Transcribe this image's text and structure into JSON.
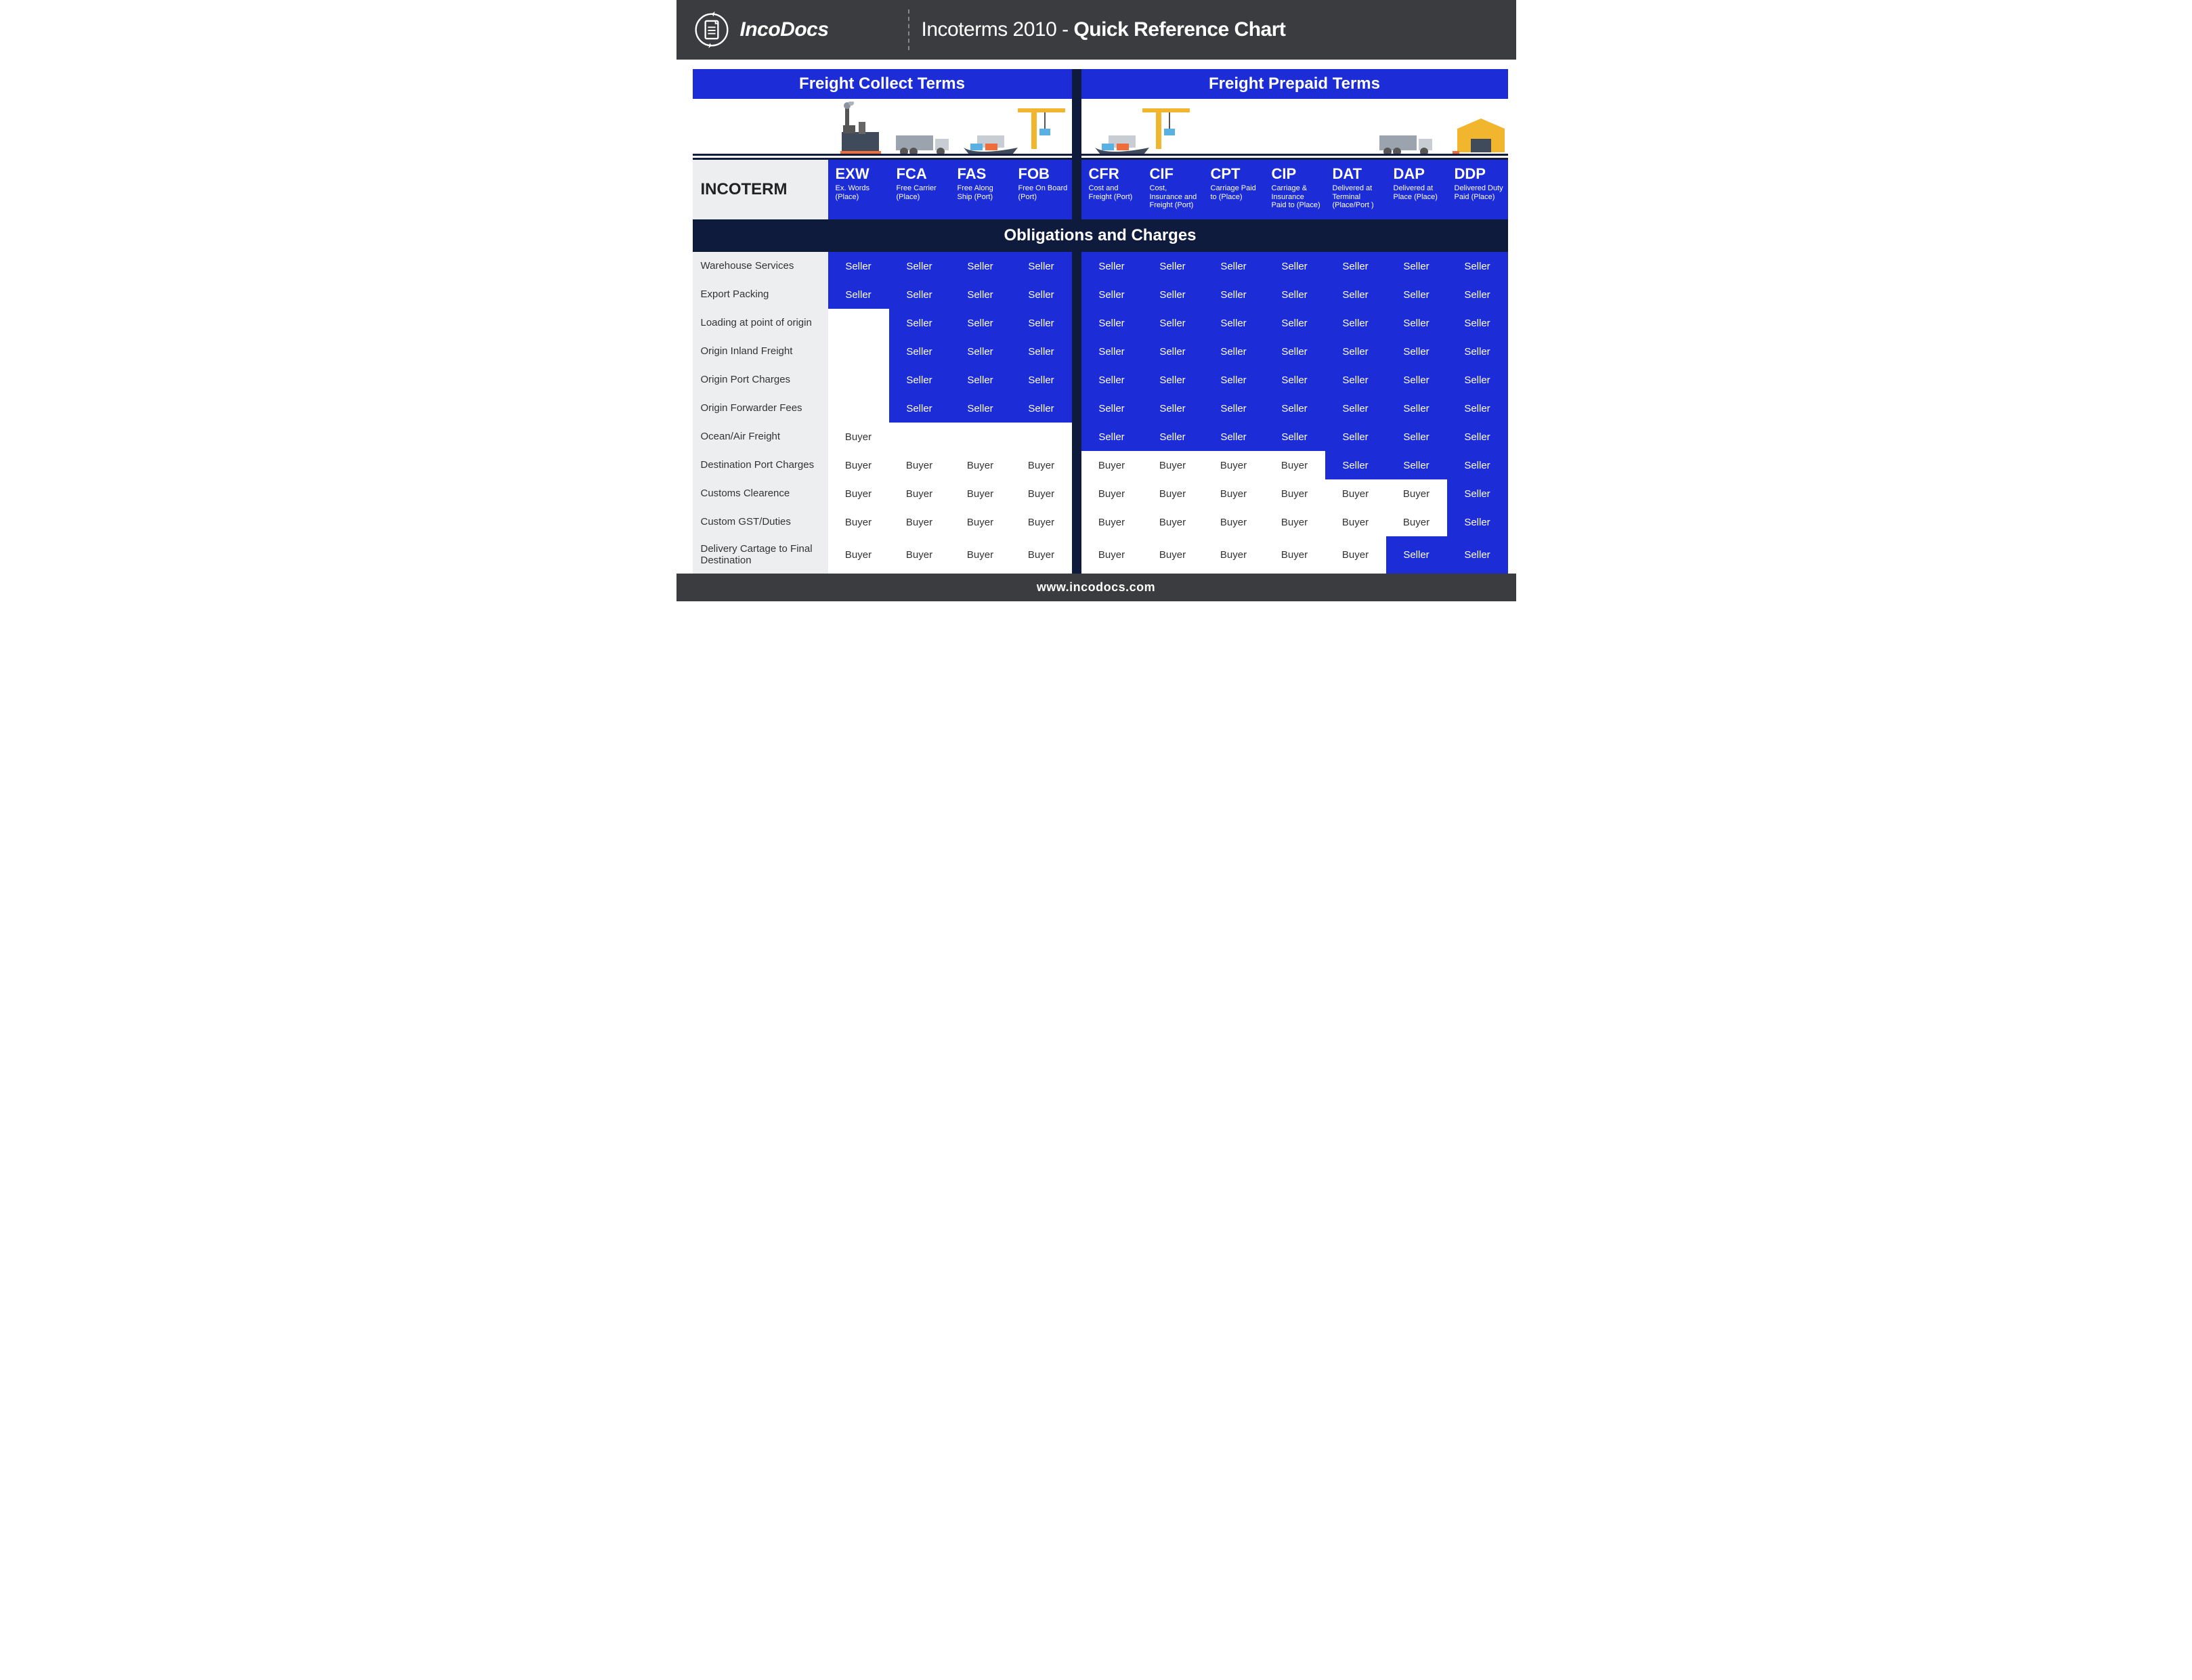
{
  "brand": "IncoDocs",
  "title_prefix": "Incoterms 2010 - ",
  "title_bold": "Quick Reference Chart",
  "sections": {
    "left": "Freight Collect Terms",
    "right": "Freight Prepaid Terms"
  },
  "incoterm_label": "INCOTERM",
  "obligations_title": "Obligations and Charges",
  "footer": "www.incodocs.com",
  "terms_left": [
    {
      "code": "EXW",
      "sub": "Ex. Words (Place)"
    },
    {
      "code": "FCA",
      "sub": "Free Carrier (Place)"
    },
    {
      "code": "FAS",
      "sub": "Free Along Ship (Port)"
    },
    {
      "code": "FOB",
      "sub": "Free On Board (Port)"
    }
  ],
  "terms_right": [
    {
      "code": "CFR",
      "sub": "Cost and Freight (Port)"
    },
    {
      "code": "CIF",
      "sub": "Cost, Insurance and Freight (Port)"
    },
    {
      "code": "CPT",
      "sub": "Carriage Paid to (Place)"
    },
    {
      "code": "CIP",
      "sub": "Carriage & Insurance Paid to (Place)"
    },
    {
      "code": "DAT",
      "sub": "Delivered at Terminal (Place/Port )"
    },
    {
      "code": "DAP",
      "sub": "Delivered at Place (Place)"
    },
    {
      "code": "DDP",
      "sub": "Delivered Duty Paid (Place)"
    }
  ],
  "rows": [
    {
      "label": "Warehouse Services",
      "vals": [
        "Seller",
        "Seller",
        "Seller",
        "Seller",
        "Seller",
        "Seller",
        "Seller",
        "Seller",
        "Seller",
        "Seller",
        "Seller"
      ]
    },
    {
      "label": "Export Packing",
      "vals": [
        "Seller",
        "Seller",
        "Seller",
        "Seller",
        "Seller",
        "Seller",
        "Seller",
        "Seller",
        "Seller",
        "Seller",
        "Seller"
      ]
    },
    {
      "label": "Loading at point of origin",
      "vals": [
        "",
        "Seller",
        "Seller",
        "Seller",
        "Seller",
        "Seller",
        "Seller",
        "Seller",
        "Seller",
        "Seller",
        "Seller"
      ]
    },
    {
      "label": "Origin Inland Freight",
      "vals": [
        "",
        "Seller",
        "Seller",
        "Seller",
        "Seller",
        "Seller",
        "Seller",
        "Seller",
        "Seller",
        "Seller",
        "Seller"
      ]
    },
    {
      "label": "Origin Port Charges",
      "vals": [
        "",
        "Seller",
        "Seller",
        "Seller",
        "Seller",
        "Seller",
        "Seller",
        "Seller",
        "Seller",
        "Seller",
        "Seller"
      ]
    },
    {
      "label": "Origin Forwarder Fees",
      "vals": [
        "",
        "Seller",
        "Seller",
        "Seller",
        "Seller",
        "Seller",
        "Seller",
        "Seller",
        "Seller",
        "Seller",
        "Seller"
      ]
    },
    {
      "label": "Ocean/Air Freight",
      "vals": [
        "Buyer",
        "",
        "",
        "",
        "Seller",
        "Seller",
        "Seller",
        "Seller",
        "Seller",
        "Seller",
        "Seller"
      ]
    },
    {
      "label": "Destination Port Charges",
      "vals": [
        "Buyer",
        "Buyer",
        "Buyer",
        "Buyer",
        "Buyer",
        "Buyer",
        "Buyer",
        "Buyer",
        "Seller",
        "Seller",
        "Seller"
      ]
    },
    {
      "label": "Customs Clearence",
      "vals": [
        "Buyer",
        "Buyer",
        "Buyer",
        "Buyer",
        "Buyer",
        "Buyer",
        "Buyer",
        "Buyer",
        "Buyer",
        "Buyer",
        "Seller"
      ]
    },
    {
      "label": "Custom GST/Duties",
      "vals": [
        "Buyer",
        "Buyer",
        "Buyer",
        "Buyer",
        "Buyer",
        "Buyer",
        "Buyer",
        "Buyer",
        "Buyer",
        "Buyer",
        "Seller"
      ]
    },
    {
      "label": "Delivery Cartage to Final Destination",
      "vals": [
        "Buyer",
        "Buyer",
        "Buyer",
        "Buyer",
        "Buyer",
        "Buyer",
        "Buyer",
        "Buyer",
        "Buyer",
        "Seller",
        "Seller"
      ]
    }
  ]
}
